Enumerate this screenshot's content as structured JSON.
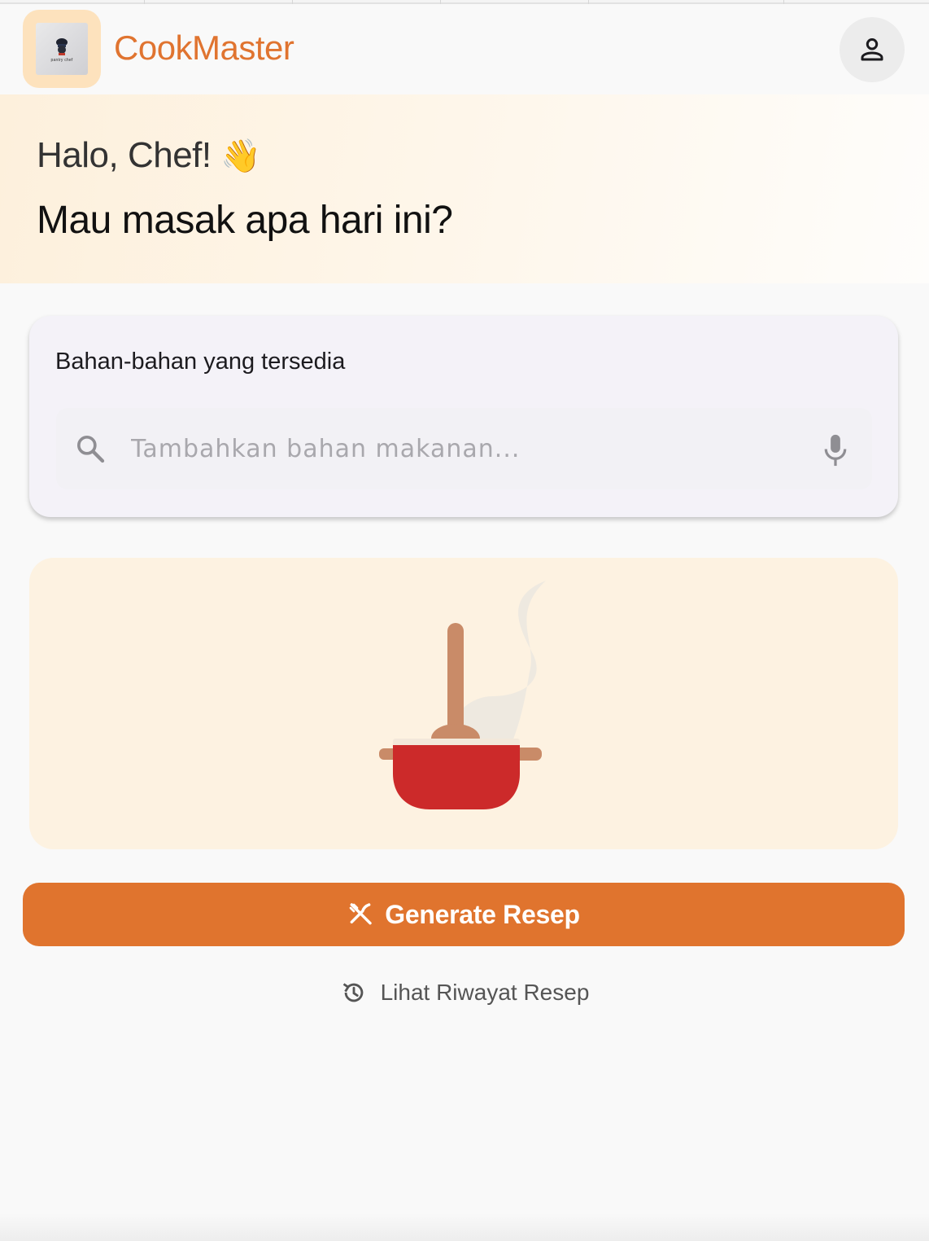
{
  "app": {
    "title": "CookMaster",
    "logo_text": "pantry chef"
  },
  "hero": {
    "greeting": "Halo, Chef!",
    "greeting_emoji": "👋",
    "question": "Mau masak apa hari ini?"
  },
  "ingredients": {
    "title": "Bahan-bahan yang tersedia",
    "search_placeholder": "Tambahkan bahan makanan...",
    "search_value": ""
  },
  "actions": {
    "generate_label": "Generate Resep",
    "history_label": "Lihat Riwayat Resep"
  },
  "icons": {
    "logo": "chef-logo-icon",
    "profile": "person-icon",
    "search": "search-icon",
    "mic": "mic-icon",
    "generate": "fork-knife-icon",
    "history": "history-icon",
    "illustration": "cooking-pot-illustration"
  },
  "colors": {
    "brand": "#e07430",
    "logo_bg": "#fde2bd",
    "hero_bg": "#fdf0dc",
    "illustration_bg": "#fdf2e1",
    "pot_red": "#cc2a2a",
    "wood": "#c98b68"
  }
}
